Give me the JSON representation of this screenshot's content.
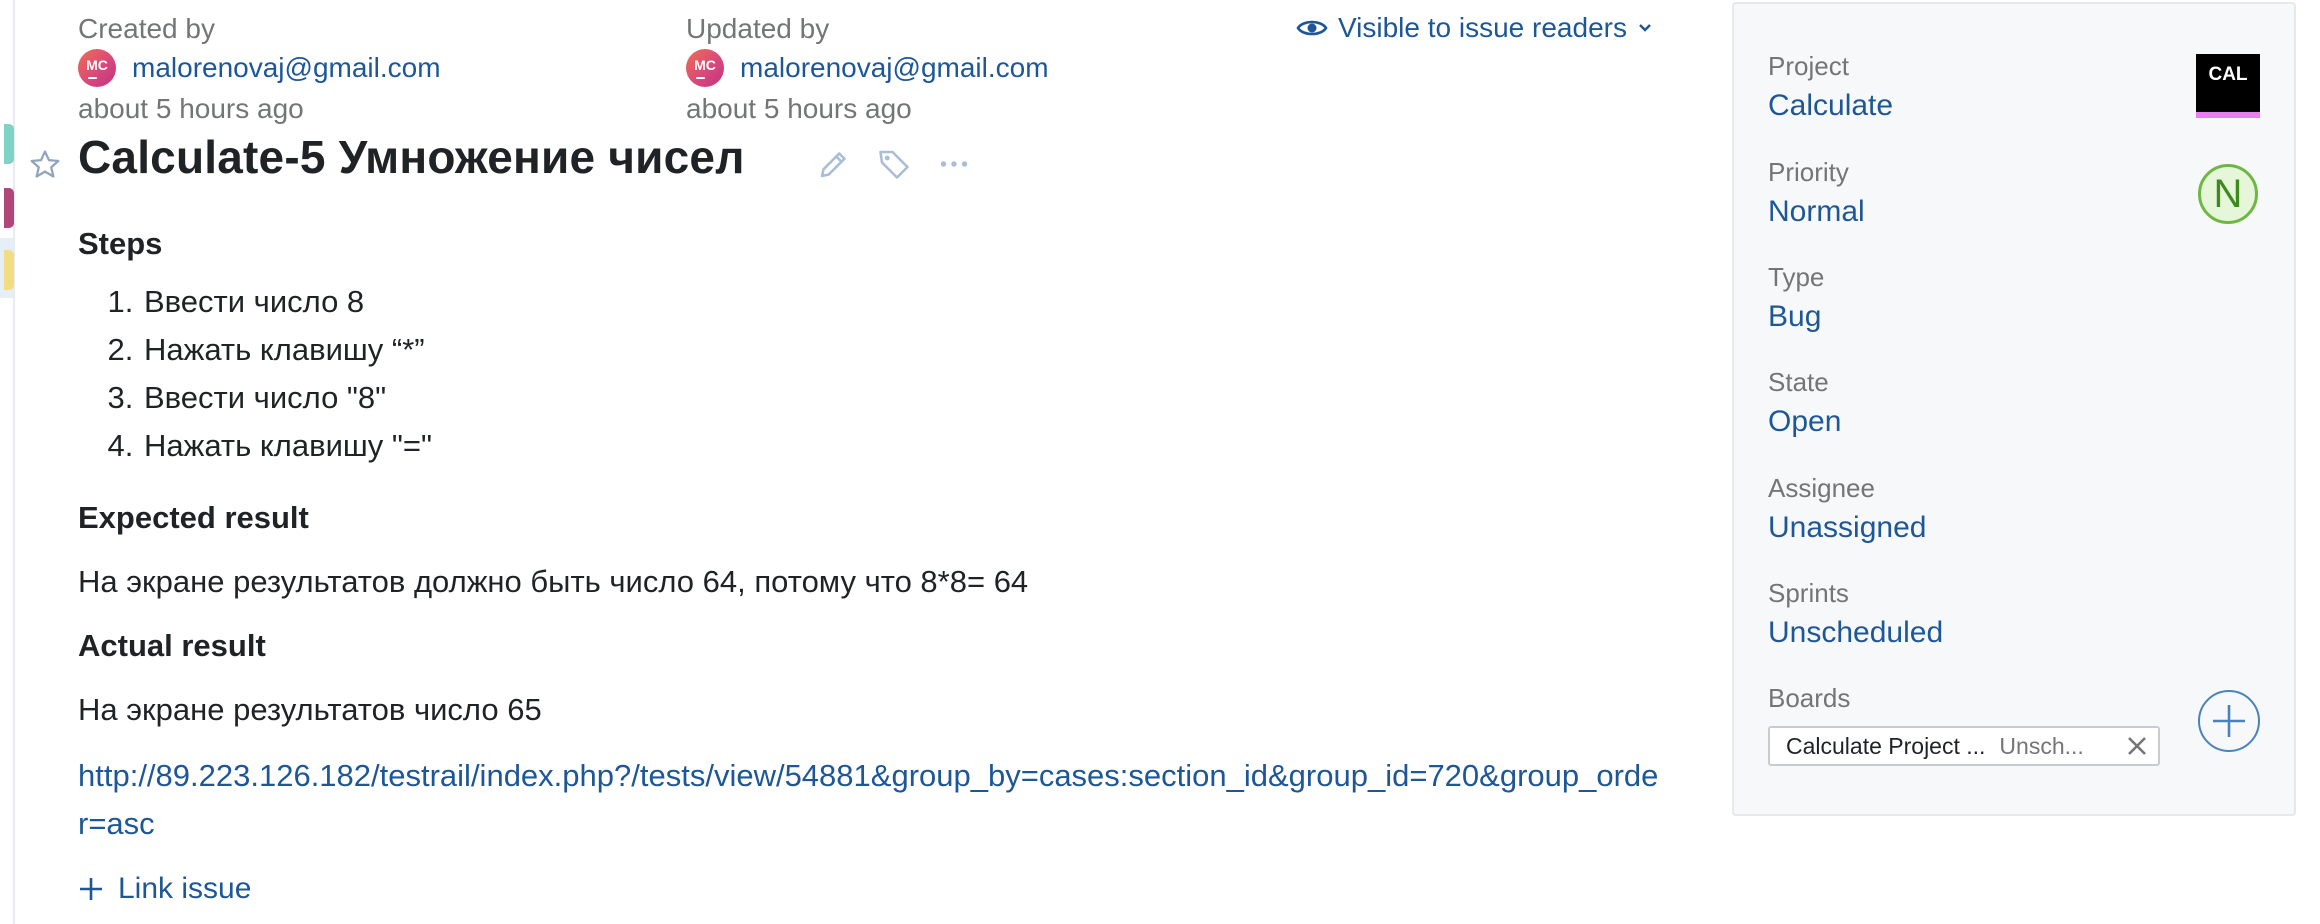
{
  "created": {
    "caption": "Created by",
    "avatar_initials": "MC",
    "email": "malorenovaj@gmail.com",
    "time": "about 5 hours ago"
  },
  "updated": {
    "caption": "Updated by",
    "avatar_initials": "MC",
    "email": "malorenovaj@gmail.com",
    "time": "about 5 hours ago"
  },
  "visibility": {
    "label": "Visible to issue readers",
    "icon": "eye-icon"
  },
  "issue": {
    "title": "Calculate-5 Умножение чисел",
    "icons": [
      "star-icon",
      "edit-icon",
      "tag-icon",
      "more-icon"
    ]
  },
  "description": {
    "steps_heading": "Steps",
    "steps": [
      "Ввести число 8",
      "Нажать клавишу “*”",
      "Ввести число \"8\"",
      "Нажать клавишу \"=\""
    ],
    "expected_heading": "Expected result",
    "expected_text": "На экране результатов должно быть число 64, потому что 8*8= 64",
    "actual_heading": "Actual result",
    "actual_text": "На экране результатов число 65",
    "url": "http://89.223.126.182/testrail/index.php?/tests/view/54881&group_by=cases:section_id&group_id=720&group_order=asc"
  },
  "link_issue": {
    "label": "Link issue"
  },
  "sidebar": {
    "project": {
      "label": "Project",
      "value": "Calculate",
      "icon_text": "CAL"
    },
    "priority": {
      "label": "Priority",
      "value": "Normal",
      "badge": "N"
    },
    "type": {
      "label": "Type",
      "value": "Bug"
    },
    "state": {
      "label": "State",
      "value": "Open"
    },
    "assignee": {
      "label": "Assignee",
      "value": "Unassigned"
    },
    "sprints": {
      "label": "Sprints",
      "value": "Unscheduled"
    },
    "boards": {
      "label": "Boards",
      "chip_name": "Calculate Project ...",
      "chip_sprint": "Unsch..."
    }
  },
  "colors": {
    "link": "#1e5797",
    "text": "#1f2326",
    "muted": "#737577",
    "priority_green": "#6fb745",
    "panel_bg": "#f7f8f9"
  }
}
